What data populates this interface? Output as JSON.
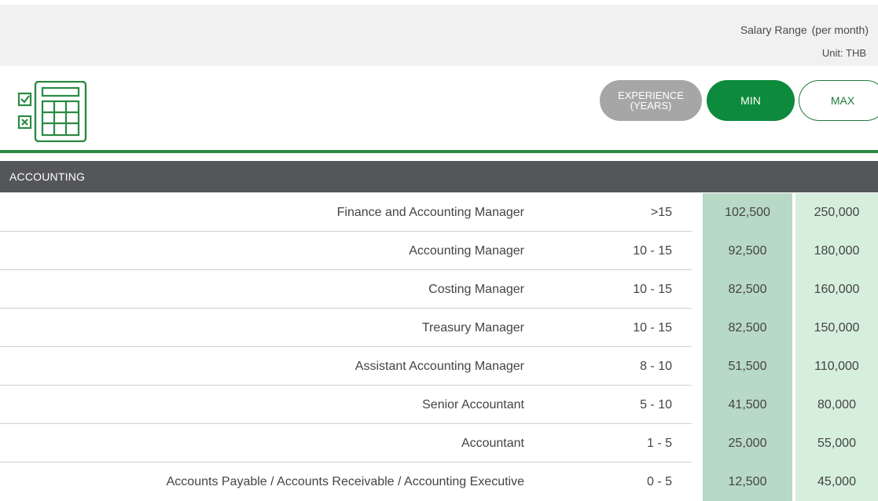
{
  "header": {
    "salary_range_label": "Salary Range",
    "per_month_label": "(per month)",
    "unit_label": "Unit: THB"
  },
  "columns": {
    "experience_line1": "EXPERIENCE",
    "experience_line2": "(YEARS)",
    "min_label": "MIN",
    "max_label": "MAX"
  },
  "colors": {
    "brand_green": "#0d8a3c",
    "header_gray": "#555659",
    "min_column": "#b8d9c5",
    "max_column": "#d6efdc"
  },
  "section": {
    "title": "ACCOUNTING",
    "rows": [
      {
        "title": "Finance and Accounting Manager",
        "experience": ">15",
        "min": "102,500",
        "max": "250,000"
      },
      {
        "title": "Accounting Manager",
        "experience": "10 - 15",
        "min": "92,500",
        "max": "180,000"
      },
      {
        "title": "Costing Manager",
        "experience": "10 - 15",
        "min": "82,500",
        "max": "160,000"
      },
      {
        "title": "Treasury Manager",
        "experience": "10 - 15",
        "min": "82,500",
        "max": "150,000"
      },
      {
        "title": "Assistant Accounting Manager",
        "experience": "8 - 10",
        "min": "51,500",
        "max": "110,000"
      },
      {
        "title": "Senior Accountant",
        "experience": "5 - 10",
        "min": "41,500",
        "max": "80,000"
      },
      {
        "title": "Accountant",
        "experience": "1 - 5",
        "min": "25,000",
        "max": "55,000"
      },
      {
        "title": "Accounts Payable / Accounts Receivable / Accounting Executive",
        "experience": "0 - 5",
        "min": "12,500",
        "max": "45,000"
      }
    ]
  },
  "icons": {
    "calculator": "calculator-checklist-icon"
  }
}
